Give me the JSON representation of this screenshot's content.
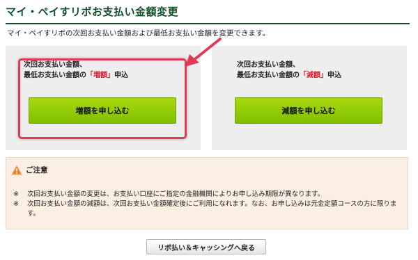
{
  "page": {
    "title": "マイ・ペイすリボお支払い金額変更",
    "intro": "マイ・ペイすリボの次回お支払い金額および最低お支払い金額を変更できます。"
  },
  "increase_panel": {
    "line1": "次回お支払い金額、",
    "line2_prefix": "最低お支払い金額の",
    "line2_highlight": "「増額」",
    "line2_suffix": "申込",
    "button_label": "増額を申し込む"
  },
  "decrease_panel": {
    "line1": "次回お支払い金額、",
    "line2_prefix": "最低お支払い金額の",
    "line2_highlight": "「減額」",
    "line2_suffix": "申込",
    "button_label": "減額を申し込む"
  },
  "notice": {
    "heading": "ご注意",
    "icon": "warning-icon",
    "items": [
      {
        "mark": "※",
        "text": "次回お支払い金額の変更は、お支払い口座にご指定の金融機関によりお申し込み期限が異なります。"
      },
      {
        "mark": "※",
        "text": "次回お支払い金額の減額は、次回お支払い金額確定後にご利用になれます。なお、お申し込みは元金定額コースの方に限ります。"
      }
    ]
  },
  "footer": {
    "back_button_label": "リボ払い＆キャッシングへ戻る"
  },
  "colors": {
    "title_green": "#0e4f2a",
    "button_green": "#8cc800",
    "highlight_red": "#e0182d",
    "annotation_pink": "#e23a55",
    "notice_bg": "#fbeee2"
  }
}
